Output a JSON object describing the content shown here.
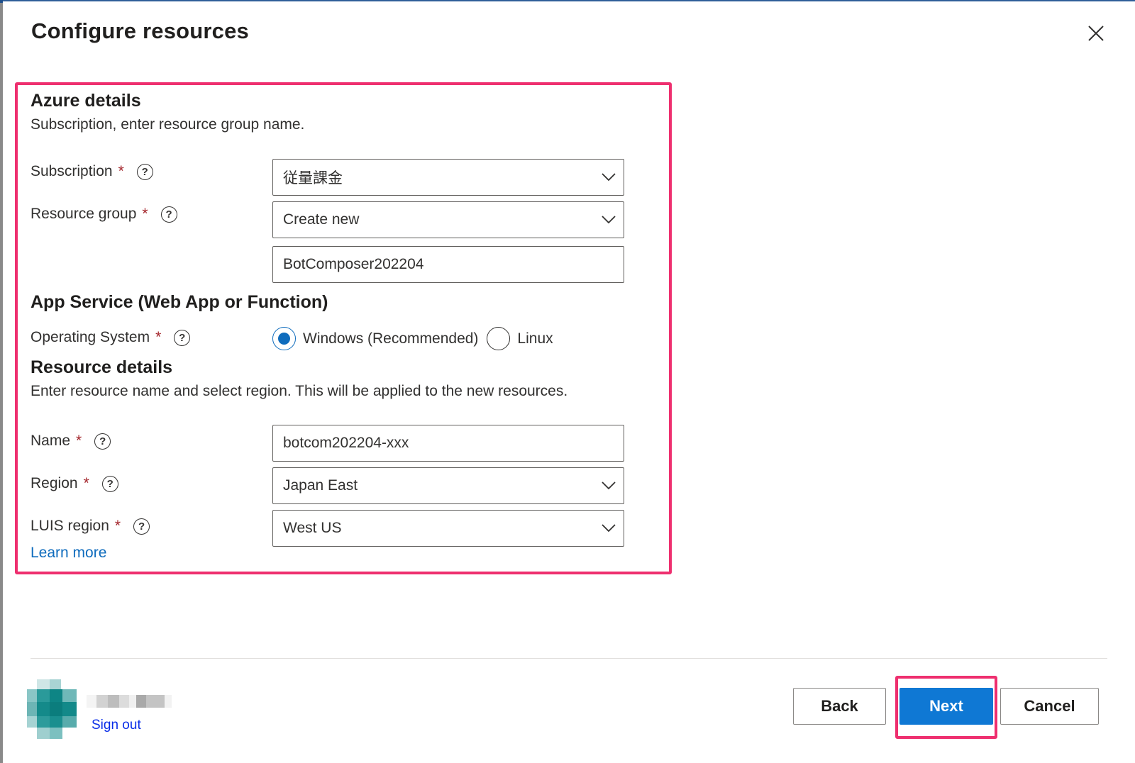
{
  "dialog": {
    "title": "Configure resources",
    "close_icon": "close-icon"
  },
  "azure_details": {
    "title": "Azure details",
    "description": "Subscription, enter resource group name.",
    "subscription": {
      "label": "Subscription",
      "required": "*",
      "value": "従量課金"
    },
    "resource_group": {
      "label": "Resource group",
      "required": "*",
      "value": "Create new",
      "name_value": "BotComposer202204"
    }
  },
  "app_service": {
    "title": "App Service (Web App or Function)",
    "os": {
      "label": "Operating System",
      "required": "*",
      "options": [
        {
          "label": "Windows (Recommended)",
          "checked": true
        },
        {
          "label": "Linux",
          "checked": false
        }
      ]
    }
  },
  "resource_details": {
    "title": "Resource details",
    "description": "Enter resource name and select region. This will be applied to the new resources.",
    "name": {
      "label": "Name",
      "required": "*",
      "value": "botcom202204-xxx"
    },
    "region": {
      "label": "Region",
      "required": "*",
      "value": "Japan East"
    },
    "luis_region": {
      "label": "LUIS region",
      "required": "*",
      "value": "West US"
    },
    "learn_more": "Learn more"
  },
  "footer": {
    "sign_out": "Sign out",
    "back": "Back",
    "next": "Next",
    "cancel": "Cancel"
  },
  "colors": {
    "primary": "#0f78d4",
    "highlight": "#ee2f6f",
    "link": "#0f6cbd",
    "required": "#a4262c"
  },
  "help_glyph": "?"
}
